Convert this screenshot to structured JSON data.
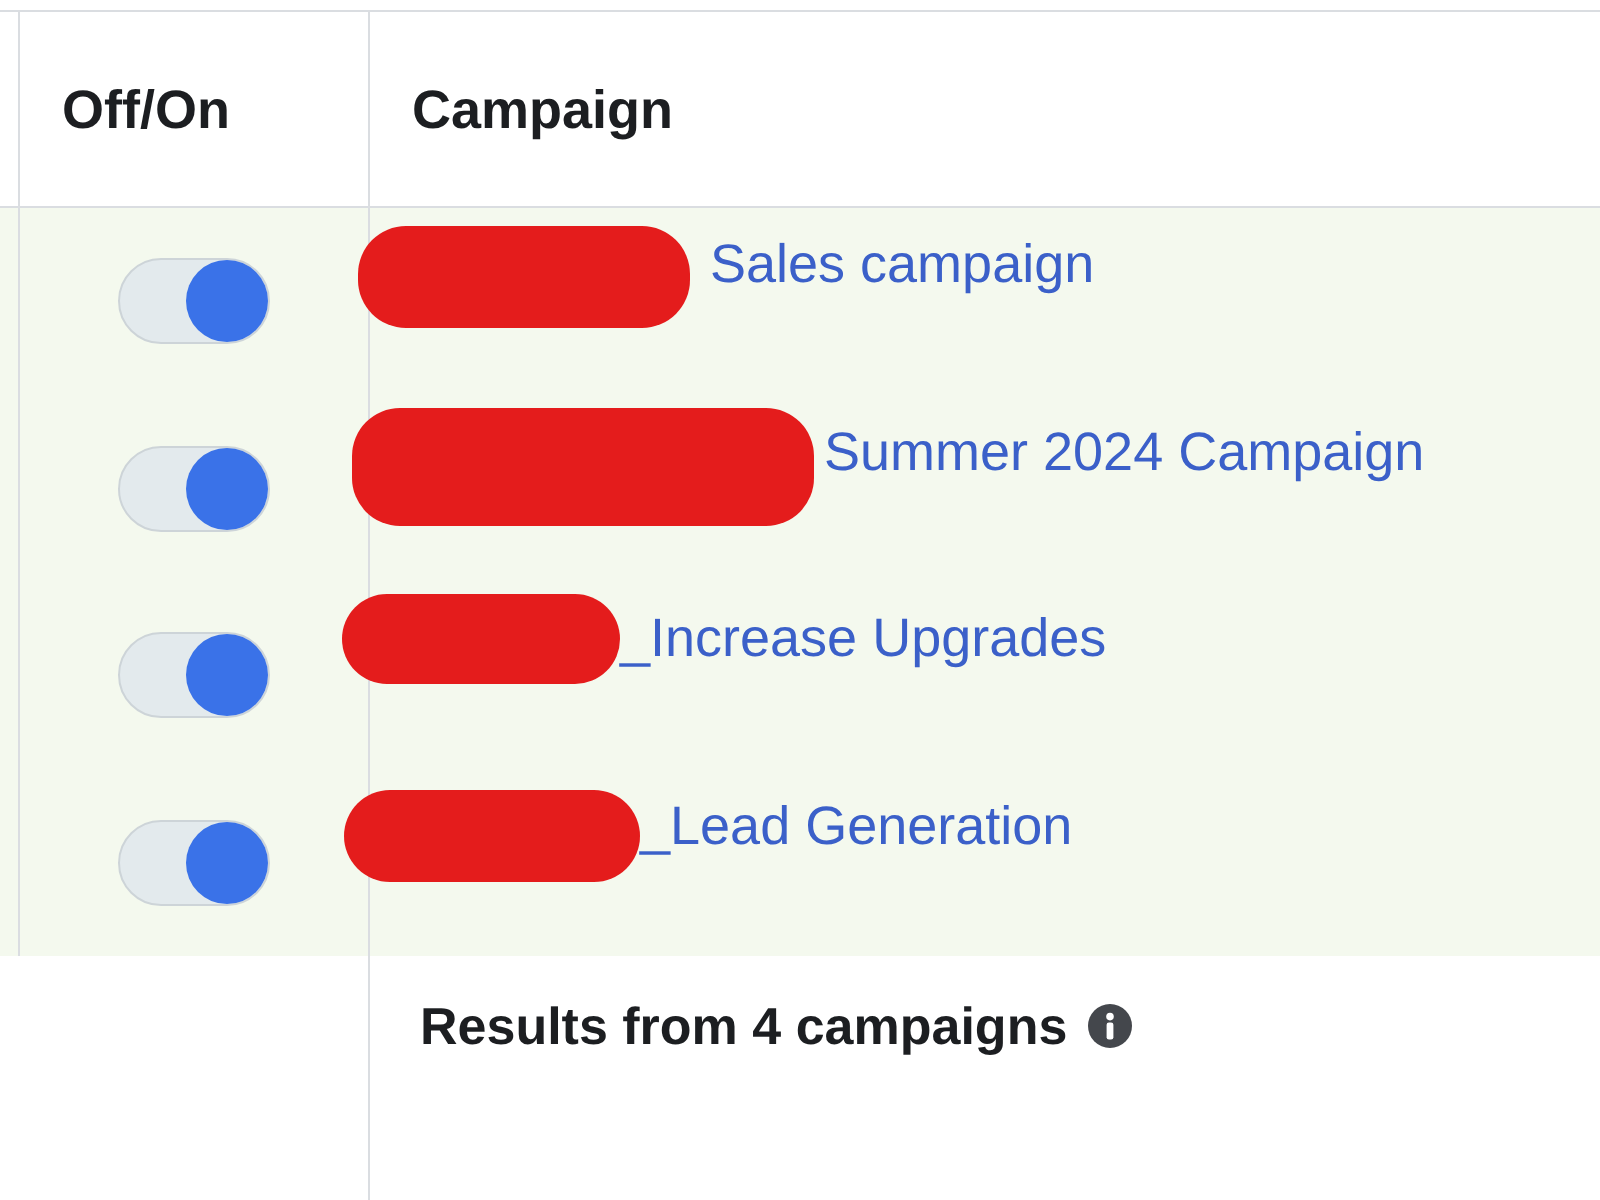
{
  "table": {
    "columns": [
      {
        "label": "Off/On"
      },
      {
        "label": "Campaign"
      }
    ],
    "rows": [
      {
        "on": true,
        "redacted": true,
        "campaign": "Sales campaign"
      },
      {
        "on": true,
        "redacted": true,
        "campaign": "Summer 2024 Campaign"
      },
      {
        "on": true,
        "redacted": true,
        "campaign": "_Increase Upgrades"
      },
      {
        "on": true,
        "redacted": true,
        "campaign": "_Lead Generation"
      }
    ]
  },
  "summary": {
    "text": "Results from 4 campaigns"
  }
}
